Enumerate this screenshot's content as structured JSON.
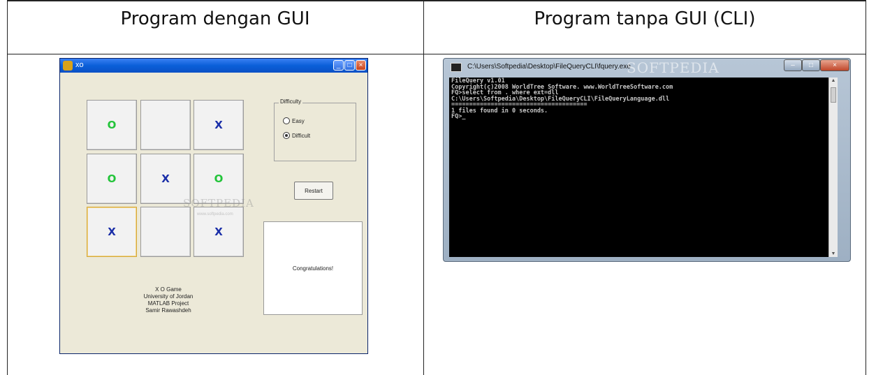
{
  "table": {
    "left_header": "Program dengan GUI",
    "right_header": "Program tanpa GUI (CLI)"
  },
  "gui_window": {
    "title": "xo",
    "board": [
      [
        "O",
        "",
        "X"
      ],
      [
        "O",
        "X",
        "O"
      ],
      [
        "X",
        "",
        "X"
      ]
    ],
    "difficulty": {
      "label": "Difficulty",
      "options": [
        "Easy",
        "Difficult"
      ],
      "selected": "Difficult"
    },
    "restart_label": "Restart",
    "message": "Congratulations!",
    "credits": [
      "X O Game",
      "University of Jordan",
      "MATLAB Project",
      "Samir Rawashdeh"
    ],
    "watermark": "SOFTPEDIA",
    "watermark_url": "www.softpedia.com"
  },
  "cli_window": {
    "title": "C:\\Users\\Softpedia\\Desktop\\FileQueryCLI\\fquery.exe",
    "watermark": "SOFTPEDIA",
    "lines": [
      "FileQuery v1.01",
      "Copyright(c)2008 WorldTree Software. www.WorldTreeSoftware.com",
      "FQ>select from . where ext=dll",
      "C:\\Users\\Softpedia\\Desktop\\FileQueryCLI\\FileQueryLanguage.dll",
      "======================================",
      "1 files found in 0 seconds.",
      "FQ>_"
    ]
  },
  "colors": {
    "o_mark": "#23c43a",
    "x_mark": "#1a2ea8",
    "console_bg": "#000000",
    "console_fg": "#c8c8c8"
  }
}
